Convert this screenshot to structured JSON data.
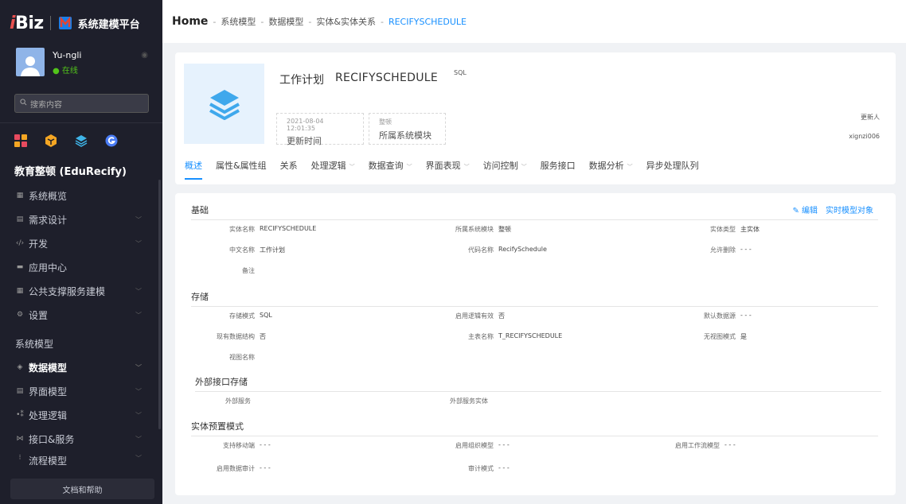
{
  "app": {
    "logo_i": "i",
    "logo_biz": "Biz",
    "title": "系统建模平台"
  },
  "user": {
    "name": "Yu-ngli",
    "status": "● 在线"
  },
  "search": {
    "placeholder": "搜索内容"
  },
  "project": {
    "title": "教育整顿 (EduRecify)"
  },
  "nav": {
    "items": [
      {
        "icon": "▦",
        "label": "系统概览",
        "chev": ""
      },
      {
        "icon": "▤",
        "label": "需求设计",
        "chev": "﹀"
      },
      {
        "icon": "‹/›",
        "label": "开发",
        "chev": "﹀"
      },
      {
        "icon": "▬",
        "label": "应用中心",
        "chev": ""
      },
      {
        "icon": "▦",
        "label": "公共支撑服务建模",
        "chev": "﹀"
      },
      {
        "icon": "⚙",
        "label": "设置",
        "chev": "﹀"
      }
    ],
    "section": "系统模型",
    "model_items": [
      {
        "icon": "◈",
        "label": "数据模型",
        "chev": "﹀"
      },
      {
        "icon": "▤",
        "label": "界面模型",
        "chev": "﹀"
      },
      {
        "icon": "•⁑",
        "label": "处理逻辑",
        "chev": "﹀"
      },
      {
        "icon": "⋈",
        "label": "接口&服务",
        "chev": "﹀"
      },
      {
        "icon": "⁝",
        "label": "流程模型",
        "chev": "﹀"
      }
    ],
    "help": "文档和帮助"
  },
  "breadcrumb": {
    "home": "Home",
    "sep": "-",
    "items": [
      "系统模型",
      "数据模型",
      "实体&实体关系"
    ],
    "current": "RECIFYSCHEDULE"
  },
  "entity": {
    "name_cn": "工作计划",
    "name_code": "RECIFYSCHEDULE",
    "tag": "SQL",
    "update_time": "2021-08-04 12:01:35",
    "update_time_label": "更新时间",
    "module": "整顿",
    "module_label": "所属系统模块",
    "updater_label": "更新人",
    "updater": "xignzi006"
  },
  "tabs": [
    {
      "label": "概述",
      "dd": ""
    },
    {
      "label": "属性&属性组",
      "dd": ""
    },
    {
      "label": "关系",
      "dd": ""
    },
    {
      "label": "处理逻辑",
      "dd": "﹀"
    },
    {
      "label": "数据查询",
      "dd": "﹀"
    },
    {
      "label": "界面表现",
      "dd": "﹀"
    },
    {
      "label": "访问控制",
      "dd": "﹀"
    },
    {
      "label": "服务接口",
      "dd": ""
    },
    {
      "label": "数据分析",
      "dd": "﹀"
    },
    {
      "label": "异步处理队列",
      "dd": ""
    }
  ],
  "actions": {
    "edit": "编辑",
    "realtime": "实时模型对象"
  },
  "sections": {
    "basic": {
      "title": "基础",
      "fields": [
        {
          "label": "实体名称",
          "value": "RECIFYSCHEDULE"
        },
        {
          "label": "所属系统模块",
          "value": "整顿"
        },
        {
          "label": "实体类型",
          "value": "主实体"
        },
        {
          "label": "中文名称",
          "value": "工作计划"
        },
        {
          "label": "代码名称",
          "value": "RecifySchedule"
        },
        {
          "label": "允许删除",
          "value": "- - -"
        },
        {
          "label": "备注",
          "value": ""
        }
      ]
    },
    "storage": {
      "title": "存储",
      "fields": [
        {
          "label": "存储模式",
          "value": "SQL"
        },
        {
          "label": "启用逻辑有效",
          "value": "否"
        },
        {
          "label": "默认数据源",
          "value": "- - -"
        },
        {
          "label": "现有数据结构",
          "value": "否"
        },
        {
          "label": "主表名称",
          "value": "T_RECIFYSCHEDULE"
        },
        {
          "label": "无视图模式",
          "value": "是"
        },
        {
          "label": "视图名称",
          "value": ""
        }
      ]
    },
    "external": {
      "title": "外部接口存储",
      "fields": [
        {
          "label": "外部服务",
          "value": ""
        },
        {
          "label": "外部服务实体",
          "value": ""
        }
      ]
    },
    "preset": {
      "title": "实体预置模式",
      "fields": [
        {
          "label": "支持移动端",
          "value": "- - -"
        },
        {
          "label": "启用组织模型",
          "value": "- - -"
        },
        {
          "label": "启用工作流模型",
          "value": "- - -"
        },
        {
          "label": "启用数据审计",
          "value": "- - -"
        },
        {
          "label": "审计模式",
          "value": "- - -"
        }
      ]
    }
  },
  "colors": {
    "accent": "#1890ff",
    "sidebar": "#1e1f2b",
    "online": "#52c41a"
  }
}
